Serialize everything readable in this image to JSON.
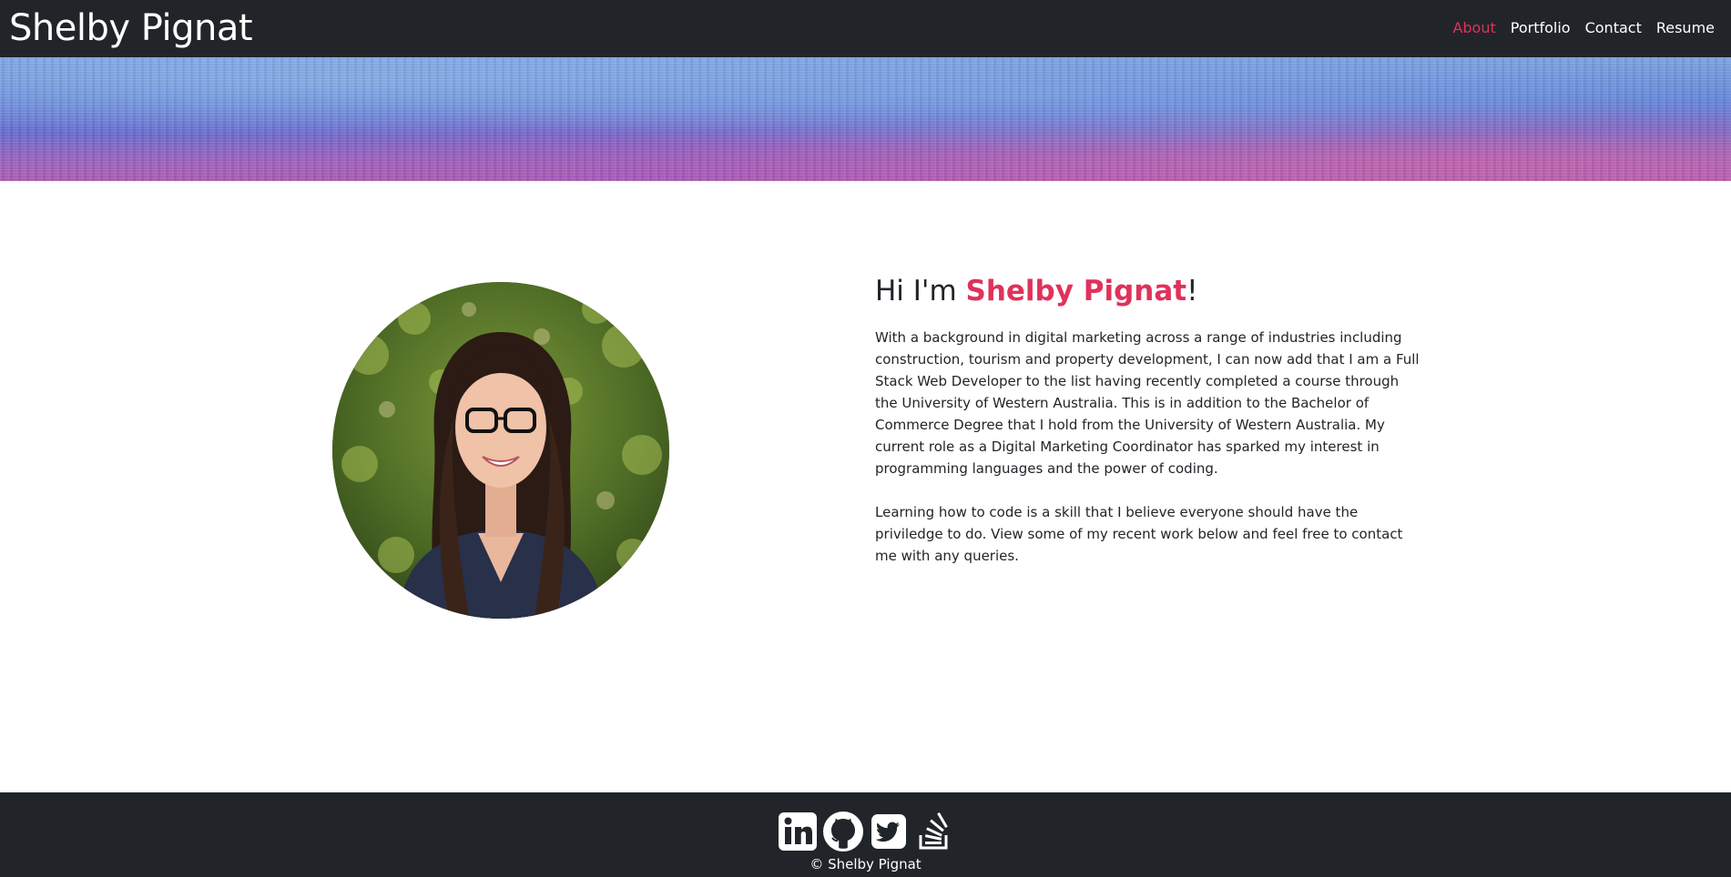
{
  "header": {
    "brand": "Shelby Pignat",
    "nav": [
      {
        "label": "About",
        "active": true
      },
      {
        "label": "Portfolio",
        "active": false
      },
      {
        "label": "Contact",
        "active": false
      },
      {
        "label": "Resume",
        "active": false
      }
    ]
  },
  "about": {
    "greeting_prefix": "Hi I'm ",
    "name": "Shelby Pignat",
    "greeting_suffix": "!",
    "paragraphs": [
      "With a background in digital marketing across a range of industries including construction, tourism and property development, I can now add that I am a Full Stack Web Developer to the list having recently completed a course through the University of Western Australia. This is in addition to the Bachelor of Commerce Degree that I hold from the University of Western Australia. My current role as a Digital Marketing Coordinator has sparked my interest in programming languages and the power of coding.",
      "Learning how to code is a skill that I believe everyone should have the priviledge to do. View some of my recent work below and feel free to contact me with any queries."
    ]
  },
  "footer": {
    "social_icons": [
      "linkedin-icon",
      "github-icon",
      "twitter-icon",
      "stackoverflow-icon"
    ],
    "copyright": "© Shelby Pignat"
  },
  "colors": {
    "accent": "#e0325a",
    "navbar_bg": "#212529",
    "text": "#212529"
  }
}
